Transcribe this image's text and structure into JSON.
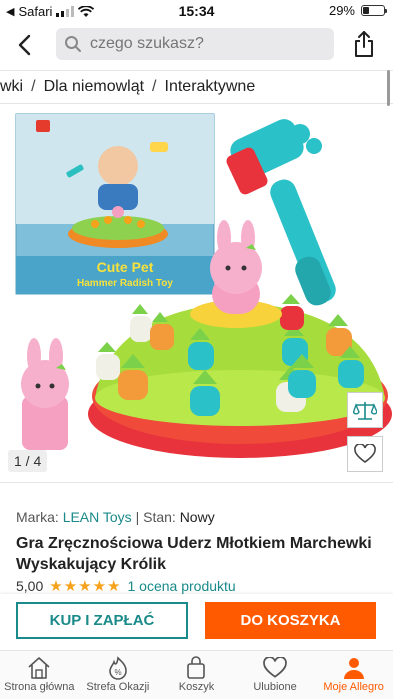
{
  "status": {
    "carrier": "Safari",
    "time": "15:34",
    "battery": "29%",
    "battery_level": 0.29
  },
  "header": {
    "search_placeholder": "czego szukasz?"
  },
  "breadcrumb": [
    "wki",
    "Dla niemowląt",
    "Interaktywne"
  ],
  "gallery": {
    "counter": "1 / 4",
    "box_title_line1": "Cute Pet",
    "box_title_line2": "Hammer Radish Toy"
  },
  "product": {
    "brand_label": "Marka:",
    "brand": "LEAN Toys",
    "condition_label": "| Stan:",
    "condition": "Nowy",
    "title": "Gra Zręcznościowa Uderz Młotkiem Marchewki Wyskakujący Królik",
    "rating_value": "5,00",
    "rating_stars": 5,
    "rating_link": "1 ocena produktu"
  },
  "actions": {
    "buy_now": "KUP I ZAPŁAĆ",
    "add_to_cart": "DO KOSZYKA"
  },
  "tabs": [
    {
      "label": "Strona główna",
      "icon": "home-icon"
    },
    {
      "label": "Strefa Okazji",
      "icon": "deals-icon"
    },
    {
      "label": "Koszyk",
      "icon": "cart-icon"
    },
    {
      "label": "Ulubione",
      "icon": "heart-icon"
    },
    {
      "label": "Moje Allegro",
      "icon": "user-icon",
      "active": true
    }
  ],
  "colors": {
    "accent_teal": "#1a8a8a",
    "accent_orange": "#ff5a00",
    "star": "#f7a21b"
  }
}
